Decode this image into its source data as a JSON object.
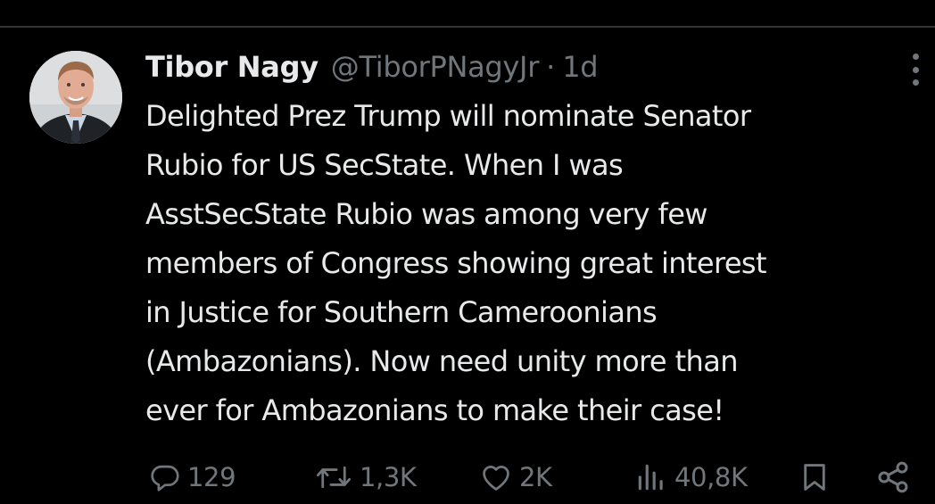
{
  "tweet": {
    "author_name": "Tibor Nagy",
    "author_handle": "@TiborPNagyJr",
    "separator": "·",
    "timestamp": "1d",
    "text_lines": [
      "Delighted Prez Trump will nominate Senator",
      "Rubio for US SecState. When I was",
      "AsstSecState Rubio was among very few",
      "members of Congress showing great interest",
      "in Justice for Southern Cameroonians",
      "(Ambazonians). Now need unity more than",
      "ever for Ambazonians to make their case!"
    ]
  },
  "actions": {
    "replies": "129",
    "reposts": "1,3K",
    "likes": "2K",
    "views": "40,8K"
  },
  "icons": {
    "avatar": "profile-photo",
    "more": "more-vertical-icon",
    "reply": "reply-icon",
    "repost": "repost-icon",
    "like": "heart-icon",
    "views": "views-icon",
    "bookmark": "bookmark-icon",
    "share": "share-icon"
  },
  "colors": {
    "background": "#000000",
    "text": "#e7e9ea",
    "secondary": "#71767b",
    "divider": "#2f3336"
  }
}
